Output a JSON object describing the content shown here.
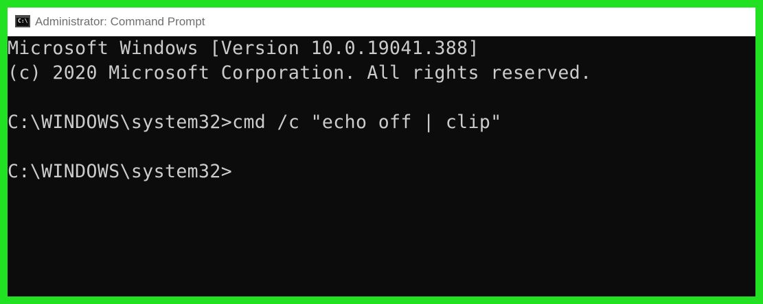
{
  "window": {
    "title": "Administrator: Command Prompt",
    "icon": "cmd-prompt-icon",
    "icon_text": "C:\\",
    "border_color": "#22e022",
    "background": "#0c0c0c",
    "text_color": "#cccccc"
  },
  "console": {
    "lines": [
      "Microsoft Windows [Version 10.0.19041.388]",
      "(c) 2020 Microsoft Corporation. All rights reserved.",
      "",
      "C:\\WINDOWS\\system32>cmd /c \"echo off | clip\"",
      "",
      "C:\\WINDOWS\\system32>"
    ]
  }
}
